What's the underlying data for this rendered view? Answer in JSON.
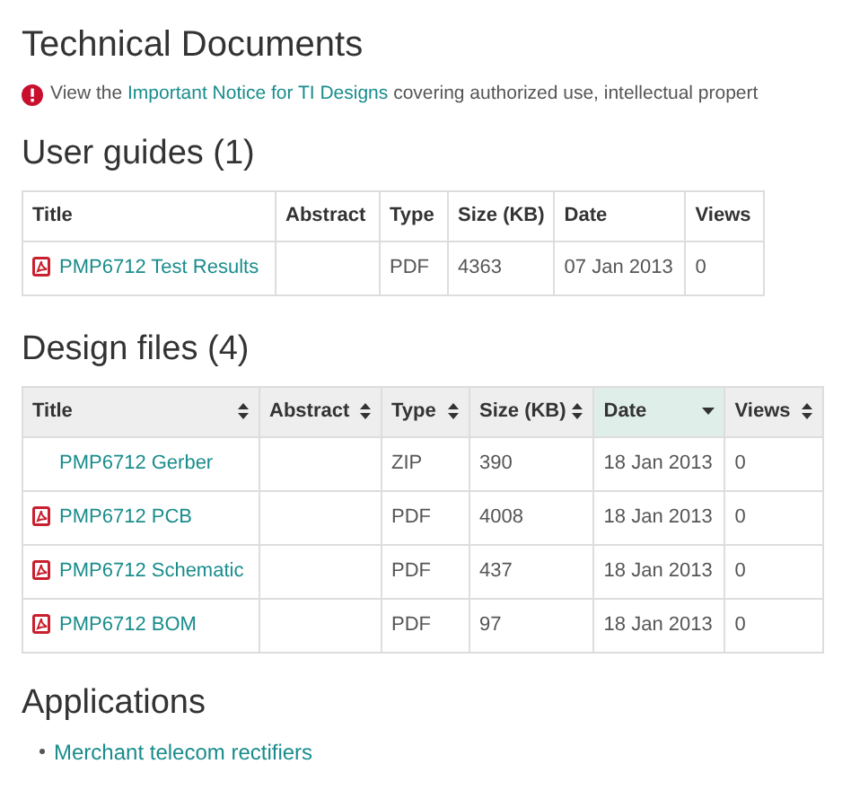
{
  "title": "Technical Documents",
  "notice": {
    "before": "View the",
    "link": "Important Notice for TI Designs",
    "after": "covering authorized use, intellectual propert"
  },
  "user_guides": {
    "heading": "User guides (1)",
    "sortable": false,
    "columns": [
      {
        "label": "Title",
        "sorted": false
      },
      {
        "label": "Abstract",
        "sorted": false
      },
      {
        "label": "Type",
        "sorted": false
      },
      {
        "label": "Size (KB)",
        "sorted": false
      },
      {
        "label": "Date",
        "sorted": false
      },
      {
        "label": "Views",
        "sorted": false
      }
    ],
    "rows": [
      {
        "title": "PMP6712 Test Results",
        "pdf_icon": true,
        "type": "PDF",
        "size": "4363",
        "date": "07 Jan 2013",
        "views": "0"
      }
    ]
  },
  "design_files": {
    "heading": "Design files (4)",
    "sortable": true,
    "columns": [
      {
        "label": "Title",
        "sorted": false
      },
      {
        "label": "Abstract",
        "sorted": false
      },
      {
        "label": "Type",
        "sorted": false
      },
      {
        "label": "Size (KB)",
        "sorted": false
      },
      {
        "label": "Date",
        "sorted": true
      },
      {
        "label": "Views",
        "sorted": false
      }
    ],
    "rows": [
      {
        "title": "PMP6712 Gerber",
        "pdf_icon": false,
        "type": "ZIP",
        "size": "390",
        "date": "18 Jan 2013",
        "views": "0"
      },
      {
        "title": "PMP6712 PCB",
        "pdf_icon": true,
        "type": "PDF",
        "size": "4008",
        "date": "18 Jan 2013",
        "views": "0"
      },
      {
        "title": "PMP6712 Schematic",
        "pdf_icon": true,
        "type": "PDF",
        "size": "437",
        "date": "18 Jan 2013",
        "views": "0"
      },
      {
        "title": "PMP6712 BOM",
        "pdf_icon": true,
        "type": "PDF",
        "size": "97",
        "date": "18 Jan 2013",
        "views": "0"
      }
    ]
  },
  "applications": {
    "heading": "Applications",
    "items": [
      "Merchant telecom rectifiers"
    ]
  }
}
